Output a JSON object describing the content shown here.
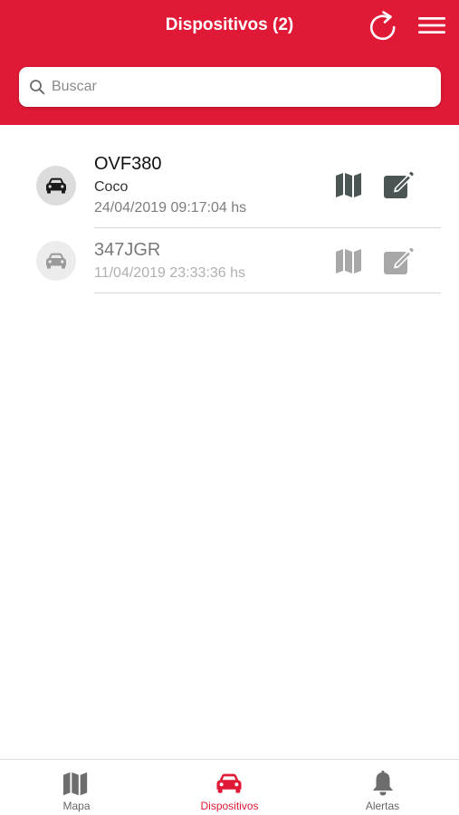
{
  "header": {
    "title": "Dispositivos (2)",
    "background": "#e01a36",
    "refresh_icon": "refresh-icon",
    "menu_icon": "hamburger-menu-icon"
  },
  "search": {
    "placeholder": "Buscar",
    "value": ""
  },
  "devices": [
    {
      "name": "OVF380",
      "subtitle": "Coco",
      "timestamp": "24/04/2019 09:17:04 hs",
      "icon": "car-icon",
      "state": "active"
    },
    {
      "name": "347JGR",
      "subtitle": "",
      "timestamp": "11/04/2019 23:33:36 hs",
      "icon": "car-icon",
      "state": "inactive"
    }
  ],
  "tabs": [
    {
      "label": "Mapa",
      "icon": "map-icon",
      "active": false
    },
    {
      "label": "Dispositivos",
      "icon": "car-icon",
      "active": true
    },
    {
      "label": "Alertas",
      "icon": "bell-icon",
      "active": false
    }
  ],
  "colors": {
    "accent": "#e01a36",
    "active_icon": "#4b5554",
    "inactive_icon": "#a8a8a8",
    "tab_icon": "#6d6d6d"
  }
}
